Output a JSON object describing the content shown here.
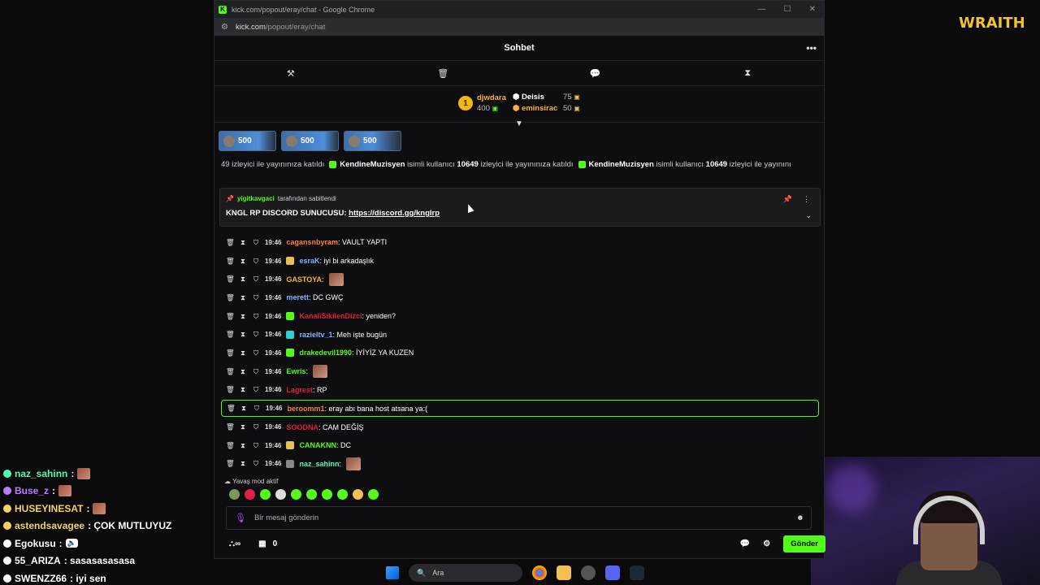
{
  "browser": {
    "window_title": "kick.com/popout/eray/chat - Google Chrome",
    "url_host": "kick.com",
    "url_path": "/popout/eray/chat"
  },
  "overlay": {
    "brand": "WRAITH",
    "chat": [
      {
        "user": "naz_sahinn",
        "text": ":",
        "color": "#53fcb5"
      },
      {
        "user": "Buse_z",
        "text": ":",
        "color": "#b87dff"
      },
      {
        "user": "HUSEYINESAT",
        "text": ":",
        "color": "#f4d35e"
      },
      {
        "user": "astendsavagee",
        "text": ": ÇOK MUTLUYUZ",
        "color": "#f4d35e"
      },
      {
        "user": "Egokusu",
        "text": ":",
        "color": "#ffffff"
      },
      {
        "user": "55_ARIZA",
        "text": ": sasasasasasa",
        "color": "#ffffff"
      },
      {
        "user": "SWENZZ66",
        "text": ": iyi sen",
        "color": "#ffffff"
      }
    ]
  },
  "chat": {
    "title": "Sohbet",
    "leaderboard": {
      "rank": "1",
      "first": {
        "name": "djwdara",
        "value": "400"
      },
      "second": {
        "name": "Deisis",
        "value": "75"
      },
      "third": {
        "name": "eminsirac",
        "value": "50"
      }
    },
    "tiers": [
      {
        "value": "500"
      },
      {
        "value": "500"
      },
      {
        "value": "500"
      }
    ],
    "ticker": {
      "lead": "49 izleyici ile yayınınıza katıldı",
      "user": "KendineMuzisyen",
      "mid": "isimli kullanıcı",
      "count": "10649",
      "tail": "izleyici ile yayınınıza katıldı",
      "trail": "izleyici ile yayınını"
    },
    "pinned": {
      "pinned_by": "yigitkavgaci",
      "pinned_suffix": "tarafından sabitlendi",
      "message": "KNGL RP DISCORD SUNUCUSU: ",
      "link": "https://discord.gg/knglrp"
    },
    "messages": [
      {
        "time": "19:46",
        "user": "cagansnbyram",
        "text": ": VAULT YAPTI",
        "color": "#f5803a",
        "badge": "",
        "emote": false
      },
      {
        "time": "19:46",
        "user": "esraK",
        "text": ": iyi bi arkadaşlık",
        "color": "#7ab7ff",
        "badge": "#e8c056",
        "emote": false
      },
      {
        "time": "19:46",
        "user": "GASTOYA",
        "text": ":",
        "color": "#f5b33a",
        "badge": "",
        "emote": true
      },
      {
        "time": "19:46",
        "user": "merett",
        "text": ": DC GWÇ",
        "color": "#7ab7ff",
        "badge": "",
        "emote": false
      },
      {
        "time": "19:46",
        "user": "KanaliSikilenDizci",
        "text": ": yeniden?",
        "color": "#e0203a",
        "badge": "#53fc18",
        "emote": false
      },
      {
        "time": "19:46",
        "user": "razieltv_1",
        "text": ": Meh işte bugün",
        "color": "#7ab7ff",
        "badge": "#2ecfcf",
        "emote": false
      },
      {
        "time": "19:46",
        "user": "drakedevil1990",
        "text": ": İYİYİZ YA KUZEN",
        "color": "#53fc18",
        "badge": "#53fc18",
        "emote": false
      },
      {
        "time": "19:46",
        "user": "Ewris",
        "text": ":",
        "color": "#53fc18",
        "badge": "",
        "emote": true
      },
      {
        "time": "19:46",
        "user": "Lagrest",
        "text": ": RP",
        "color": "#e0203a",
        "badge": "",
        "emote": false
      },
      {
        "time": "19:46",
        "user": "beroomm1",
        "text": ": eray abı bana host atsana ya:(",
        "color": "#f5803a",
        "badge": "",
        "emote": false,
        "highlight": true
      },
      {
        "time": "19:46",
        "user": "SOODNA",
        "text": ": CAM DEĞİŞ",
        "color": "#e0203a",
        "badge": "",
        "emote": false
      },
      {
        "time": "19:46",
        "user": "CANAKNN",
        "text": ": DC",
        "color": "#53fc18",
        "badge": "#e8c056",
        "emote": false
      },
      {
        "time": "19:46",
        "user": "naz_sahinn",
        "text": ":",
        "color": "#53fcb5",
        "badge": "#888888",
        "emote": true
      }
    ],
    "slow_mode": "Yavaş mod aktif",
    "input_placeholder": "Bir mesaj gönderin",
    "points": "0",
    "send_label": "Gönder"
  },
  "taskbar": {
    "search_label": "Ara"
  },
  "colors": {
    "accent": "#53fc18",
    "background": "#0e0e10"
  }
}
